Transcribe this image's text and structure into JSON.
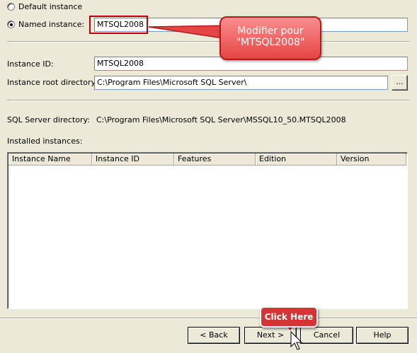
{
  "instance_selection": {
    "default_label": "Default instance",
    "named_label": "Named instance:",
    "named_value": "MTSQL2008",
    "selected": "named"
  },
  "instance_id": {
    "label": "Instance ID:",
    "value": "MTSQL2008"
  },
  "root_directory": {
    "label": "Instance root directory:",
    "value": "C:\\Program Files\\Microsoft SQL Server\\",
    "browse_label": "..."
  },
  "sql_server_directory": {
    "label": "SQL Server directory:",
    "value": "C:\\Program Files\\Microsoft SQL Server\\MSSQL10_50.MTSQL2008"
  },
  "installed_instances": {
    "label": "Installed instances:",
    "columns": [
      "Instance Name",
      "Instance ID",
      "Features",
      "Edition",
      "Version"
    ],
    "rows": []
  },
  "annotations": {
    "callout_line1": "Modifier pour",
    "callout_line2": "\"MTSQL2008\"",
    "click_here": "Click Here"
  },
  "buttons": {
    "back": "< Back",
    "next": "Next >",
    "cancel": "Cancel",
    "help": "Help"
  },
  "colors": {
    "window_bg": "#ece9d8",
    "callout_red": "#e64545",
    "highlight_border": "#c00000"
  },
  "icons": [
    "radio-unselected-icon",
    "radio-selected-icon",
    "mouse-cursor-icon"
  ]
}
